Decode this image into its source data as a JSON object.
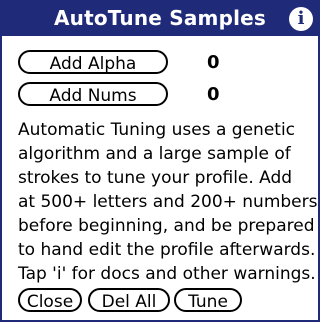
{
  "titlebar": {
    "title": "AutoTune Samples",
    "info_icon_glyph": "i",
    "info_icon_name": "info-icon"
  },
  "rows": [
    {
      "label": "Add Alpha",
      "count": "0"
    },
    {
      "label": "Add Nums",
      "count": "0"
    }
  ],
  "description_lines": [
    "Automatic Tuning uses a genetic",
    "algorithm and a large sample of",
    "strokes to tune your profile. Add",
    "at 500+ letters and 200+ numbers",
    "before beginning, and be prepared",
    "to hand edit the profile afterwards.",
    "Tap 'i' for docs and other warnings."
  ],
  "buttons": {
    "close": "Close",
    "del_all": "Del All",
    "tune": "Tune"
  },
  "colors": {
    "titlebar_bg": "#1f2a78",
    "titlebar_text": "#ffffff",
    "body_bg": "#ffffff",
    "text": "#000000"
  }
}
